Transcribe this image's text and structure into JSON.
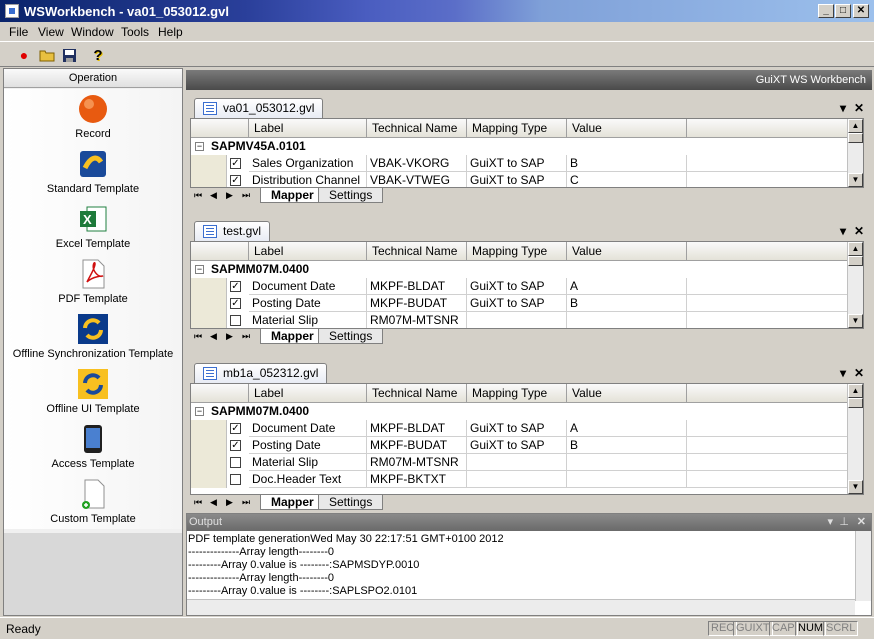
{
  "window": {
    "title": "WSWorkbench - va01_053012.gvl",
    "min": "_",
    "max": "□",
    "close": "✕"
  },
  "menu": [
    "File",
    "View",
    "Window",
    "Tools",
    "Help"
  ],
  "toolbar": [
    {
      "name": "record-icon",
      "glyph": "●",
      "color": "#e00000"
    },
    {
      "name": "open-folder-icon",
      "glyph": "📂"
    },
    {
      "name": "save-icon",
      "glyph": "💾"
    },
    {
      "name": "help-icon",
      "glyph": "?"
    }
  ],
  "operations": {
    "header": "Operation",
    "items": [
      {
        "label": "Record",
        "icon": "record-orb-icon"
      },
      {
        "label": "Standard Template",
        "icon": "standard-template-icon"
      },
      {
        "label": "Excel Template",
        "icon": "excel-icon"
      },
      {
        "label": "PDF Template",
        "icon": "pdf-icon"
      },
      {
        "label": "Offline Synchronization Template",
        "icon": "sync-icon"
      },
      {
        "label": "Offline UI Template",
        "icon": "offline-ui-icon"
      },
      {
        "label": "Access Template",
        "icon": "device-icon"
      },
      {
        "label": "Custom Template",
        "icon": "custom-doc-icon"
      }
    ]
  },
  "header_bar": "GuiXT WS Workbench",
  "columns": [
    "Label",
    "Technical Name",
    "Mapping Type",
    "Value"
  ],
  "sheet_tabs": [
    "Mapper",
    "Settings"
  ],
  "docs": [
    {
      "tab": "va01_053012.gvl",
      "group": "SAPMV45A.0101",
      "rows": [
        {
          "checked": true,
          "label": "Sales Organization",
          "tech": "VBAK-VKORG",
          "map": "GuiXT to SAP",
          "value": "B"
        },
        {
          "checked": true,
          "label": "Distribution Channel",
          "tech": "VBAK-VTWEG",
          "map": "GuiXT to SAP",
          "value": "C"
        }
      ]
    },
    {
      "tab": "test.gvl",
      "group": "SAPMM07M.0400",
      "rows": [
        {
          "checked": true,
          "label": "Document Date",
          "tech": "MKPF-BLDAT",
          "map": "GuiXT to SAP",
          "value": "A"
        },
        {
          "checked": true,
          "label": "Posting Date",
          "tech": "MKPF-BUDAT",
          "map": "GuiXT to SAP",
          "value": "B"
        },
        {
          "checked": false,
          "label": "Material Slip",
          "tech": "RM07M-MTSNR",
          "map": "",
          "value": ""
        }
      ]
    },
    {
      "tab": "mb1a_052312.gvl",
      "group": "SAPMM07M.0400",
      "rows": [
        {
          "checked": true,
          "label": "Document Date",
          "tech": "MKPF-BLDAT",
          "map": "GuiXT to SAP",
          "value": "A"
        },
        {
          "checked": true,
          "label": "Posting Date",
          "tech": "MKPF-BUDAT",
          "map": "GuiXT to SAP",
          "value": "B"
        },
        {
          "checked": false,
          "label": "Material Slip",
          "tech": "RM07M-MTSNR",
          "map": "",
          "value": ""
        },
        {
          "checked": false,
          "label": "Doc.Header Text",
          "tech": "MKPF-BKTXT",
          "map": "",
          "value": ""
        }
      ]
    }
  ],
  "output": {
    "title": "Output",
    "lines": [
      "PDF template generationWed May 30 22:17:51 GMT+0100 2012",
      "--------------Array length--------0",
      "---------Array 0.value is --------:SAPMSDYP.0010",
      "--------------Array length--------0",
      "---------Array 0.value is --------:SAPLSPO2.0101"
    ]
  },
  "status": {
    "text": "Ready",
    "indicators": [
      {
        "label": "REC",
        "on": false
      },
      {
        "label": "GUIXT",
        "on": false
      },
      {
        "label": "CAP",
        "on": false
      },
      {
        "label": "NUM",
        "on": true
      },
      {
        "label": "SCRL",
        "on": false
      }
    ]
  }
}
